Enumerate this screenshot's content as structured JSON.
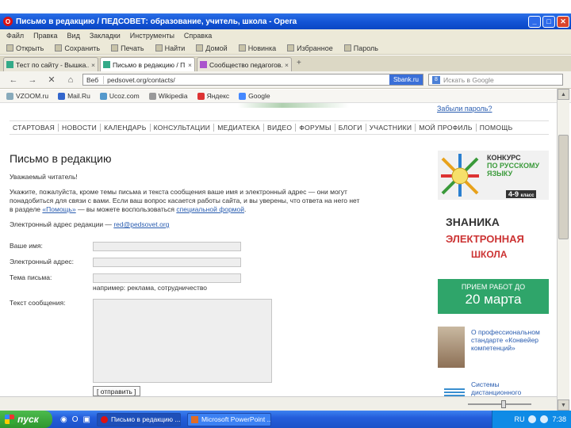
{
  "window": {
    "title": "Письмо в редакцию / ПЕДСОВЕТ: образование, учитель, школа - Opera"
  },
  "menu": [
    "Файл",
    "Правка",
    "Вид",
    "Закладки",
    "Инструменты",
    "Справка"
  ],
  "bookmarks_bar": [
    "Открыть",
    "Сохранить",
    "Печать",
    "Найти",
    "Домой",
    "Новинка",
    "Избранное",
    "Пароль"
  ],
  "tabs": [
    {
      "label": "Тест по сайту - Вышка...",
      "close": "×"
    },
    {
      "label": "Письмо в редакцию / П...",
      "close": "×"
    },
    {
      "label": "Сообщество педагогов...",
      "close": "×"
    }
  ],
  "nav": {
    "back": "←",
    "forward": "→",
    "stop": "✕",
    "home": "⌂",
    "site_label": "Веб",
    "url": "pedsovet.org/contacts/",
    "selection": "Sbank.ru",
    "search_placeholder": "Искать в Google",
    "search_engine": "8"
  },
  "quick_links": [
    "VZOOM.ru",
    "Mail.Ru",
    "Ucoz.com",
    "Wikipedia",
    "Яндекс",
    "Google"
  ],
  "page": {
    "forgot_password": "Забыли пароль?",
    "site_nav": [
      "СТАРТОВАЯ",
      "НОВОСТИ",
      "КАЛЕНДАРЬ",
      "КОНСУЛЬТАЦИИ",
      "МЕДИАТЕКА",
      "ВИДЕО",
      "ФОРУМЫ",
      "БЛОГИ",
      "УЧАСТНИКИ",
      "МОЙ ПРОФИЛЬ",
      "ПОМОЩЬ"
    ],
    "heading": "Письмо в редакцию",
    "greeting": "Уважаемый читатель!",
    "para1_line1": "Укажите, пожалуйста, кроме темы письма и текста сообщения ваше имя и электронный адрес — они могут",
    "para1_line2": "понадобиться для связи с вами. Если ваш вопрос касается работы сайта, и вы уверены, что ответа на него нет",
    "para1_line3_pre": "в разделе ",
    "para1_link1": "«Помощь»",
    "para1_line3_mid": " — вы можете воспользоваться ",
    "para1_link2": "специальной формой",
    "para1_line3_post": ".",
    "email_label": "Электронный адрес редакции — ",
    "email": "red@pedsovet.org",
    "fields": {
      "name": "Ваше имя:",
      "email": "Электронный адрес:",
      "subject": "Тема письма:",
      "subject_hint": "например: реклама, сотрудничество",
      "message": "Текст сообщения:"
    },
    "send_button": "[ отправить ]"
  },
  "sidebar": {
    "ad1_line1": "КОНКУРС",
    "ad1_line2": "ПО РУССКОМУ",
    "ad1_line3": "ЯЗЫКУ",
    "ad1_grade": "4-9",
    "ad1_grade_suffix": "класс",
    "ad2_line1": "ЗНАНИКА",
    "ad2_line2": "ЭЛЕКТРОННАЯ",
    "ad2_line3": "ШКОЛА",
    "ad3_line1": "ПРИЕМ РАБОТ ДО",
    "ad3_line2": "20 марта",
    "news1": "О профессиональном стандарте «Конвейер компетенций»",
    "news2": "Системы дистанционного"
  },
  "taskbar": {
    "start": "пуск",
    "tasks": [
      "Письмо в редакцию ...",
      "Microsoft PowerPoint ..."
    ],
    "time": "7:38",
    "lang": "RU"
  }
}
